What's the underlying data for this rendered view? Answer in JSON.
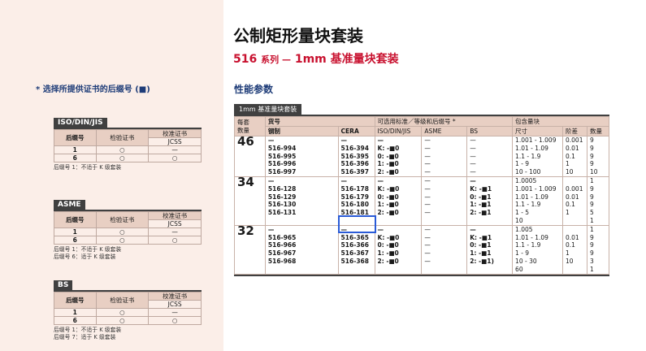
{
  "title": "公制矩形量块套装",
  "subtitle": {
    "series": "516",
    "series_suffix": "系列 —",
    "product": "1mm 基准量块套装"
  },
  "sidebar": {
    "heading": "* 选择所提供证书的后缀号 (■)",
    "blocks": [
      {
        "name": "ISO/DIN/JIS",
        "col_suffix": "后缀号",
        "col_inspect": "检验证书",
        "col_calib": "校准证书",
        "sub_jcss": "JCSS",
        "rows": [
          {
            "suffix": "1",
            "inspect": "○",
            "calib": "—"
          },
          {
            "suffix": "6",
            "inspect": "○",
            "calib": "○"
          }
        ],
        "notes": [
          "后缀号 1：不适于 K 级套装"
        ]
      },
      {
        "name": "ASME",
        "col_suffix": "后缀号",
        "col_inspect": "检验证书",
        "col_calib": "校准证书",
        "sub_jcss": "JCSS",
        "rows": [
          {
            "suffix": "1",
            "inspect": "○",
            "calib": "—"
          },
          {
            "suffix": "6",
            "inspect": "○",
            "calib": "○"
          }
        ],
        "notes": [
          "后缀号 1：不适于 K 级套装",
          "后缀号 6：适于 K 级套装"
        ]
      },
      {
        "name": "BS",
        "col_suffix": "后缀号",
        "col_inspect": "检验证书",
        "col_calib": "校准证书",
        "sub_jcss": "JCSS",
        "rows": [
          {
            "suffix": "1",
            "inspect": "○",
            "calib": "—"
          },
          {
            "suffix": "6",
            "inspect": "○",
            "calib": "○"
          }
        ],
        "notes": [
          "后缀号 1：不适于 K 级套装",
          "后缀号 7：适于 K 级套装"
        ]
      }
    ]
  },
  "section": {
    "title": "性能参数",
    "set_label": "1mm 基准量块套装",
    "headers": {
      "count": "每套\n数量",
      "order_no": "货号",
      "steel": "钢制",
      "cera": "CERA",
      "std_group": "可选用标准／等级和后缀号 *",
      "iso": "ISO/DIN/JIS",
      "asme": "ASME",
      "bs": "BS",
      "contents": "包含量块",
      "size": "尺寸",
      "pitch": "阶差",
      "qty": "数量"
    },
    "groups": [
      {
        "count": "46",
        "steel": "—\n516-994\n516-995\n516-996\n516-997",
        "cera": "—\n516-394\n516-395\n516-396\n516-397",
        "iso": "—\nK: -■0\n0: -■0\n1: -■0\n2: -■0",
        "asme": "—\n—\n—\n—\n—",
        "bs": "—\n—\n—\n—\n—",
        "size": "1.001 - 1.009\n1.01 - 1.09\n1.1 - 1.9\n1 - 9\n10 - 100",
        "pitch": "0.001\n0.01\n0.1\n1\n10",
        "qty": "9\n9\n9\n9\n10"
      },
      {
        "count": "34",
        "steel": "—\n516-128\n516-129\n516-130\n516-131",
        "cera": "—\n516-178\n516-179\n516-180\n516-181",
        "iso": "—\nK: -■0\n0: -■0\n1: -■0\n2: -■0",
        "asme": "—\n—\n—\n—\n—",
        "bs": "—\nK: -■1\n0: -■1\n1: -■1\n2: -■1",
        "size": "1.0005\n1.001 - 1.009\n1.01 - 1.09\n1.1 - 1.9\n1 - 5\n10",
        "pitch": "\n0.001\n0.01\n0.1\n1\n",
        "qty": "1\n9\n9\n9\n5\n1"
      },
      {
        "count": "32",
        "steel": "—\n516-965\n516-966\n516-967\n516-968",
        "cera": "—\n516-365\n516-366\n516-367\n516-368",
        "iso": "—\nK: -■0\n0: -■0\n1: -■0\n2: -■0",
        "asme": "—\n—\n—\n—\n—",
        "bs": "—\nK: -■1\n0: -■1\n1: -■1\n2: -■1)",
        "size": "1.005\n1.01 - 1.09\n1.1 - 1.9\n1 - 9\n10 - 30\n60",
        "pitch": "\n0.01\n0.1\n1\n10\n",
        "qty": "1\n9\n9\n9\n3\n1"
      }
    ]
  }
}
